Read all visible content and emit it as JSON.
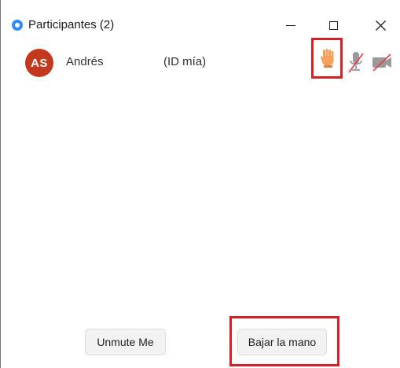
{
  "window": {
    "title": "Participantes (2)"
  },
  "participant": {
    "initials": "AS",
    "name": "Andrés",
    "tag": "(ID mía)",
    "avatar_color": "#c4391d",
    "icons": [
      "raised-hand-icon",
      "mic-muted-icon",
      "video-off-icon"
    ]
  },
  "footer": {
    "unmute_label": "Unmute Me",
    "lower_hand_label": "Bajar la mano"
  },
  "colors": {
    "highlight": "#d42027",
    "hand": "#f5a15d",
    "muted_slash": "#e0474c",
    "zoom_blue": "#2d8cff"
  }
}
